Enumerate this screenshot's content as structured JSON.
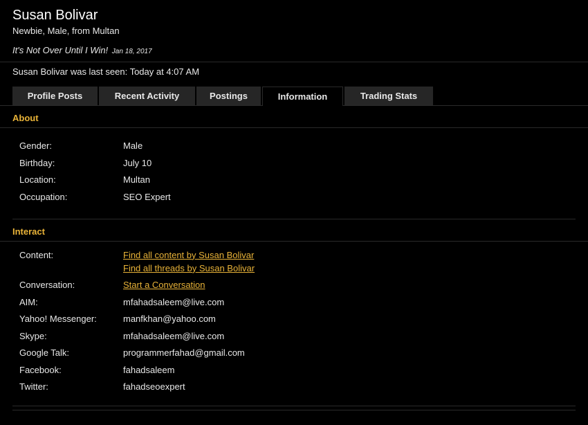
{
  "profile": {
    "name": "Susan Bolivar",
    "blurb": "Newbie, Male, from Multan",
    "status": "It's Not Over Until I Win!",
    "status_date": "Jan 18, 2017",
    "last_seen": "Susan Bolivar was last seen: Today at 4:07 AM"
  },
  "tabs": [
    {
      "label": "Profile Posts",
      "active": false
    },
    {
      "label": "Recent Activity",
      "active": false
    },
    {
      "label": "Postings",
      "active": false
    },
    {
      "label": "Information",
      "active": true
    },
    {
      "label": "Trading Stats",
      "active": false
    }
  ],
  "about": {
    "heading": "About",
    "rows": [
      {
        "label": "Gender:",
        "value": "Male"
      },
      {
        "label": "Birthday:",
        "value": "July 10"
      },
      {
        "label": "Location:",
        "value": "Multan"
      },
      {
        "label": "Occupation:",
        "value": "SEO Expert"
      }
    ]
  },
  "interact": {
    "heading": "Interact",
    "content_label": "Content:",
    "content_link_1": "Find all content by Susan Bolivar",
    "content_link_2": "Find all threads by Susan Bolivar",
    "conversation_label": "Conversation:",
    "conversation_link": "Start a Conversation",
    "rows": [
      {
        "label": "AIM:",
        "value": "mfahadsaleem@live.com"
      },
      {
        "label": "Yahoo! Messenger:",
        "value": "manfkhan@yahoo.com"
      },
      {
        "label": "Skype:",
        "value": "mfahadsaleem@live.com"
      },
      {
        "label": "Google Talk:",
        "value": "programmerfahad@gmail.com"
      },
      {
        "label": "Facebook:",
        "value": "fahadsaleem"
      },
      {
        "label": "Twitter:",
        "value": "fahadseoexpert"
      }
    ]
  },
  "colors": {
    "background": "#000000",
    "accent": "#e9b338",
    "tab_background": "#262626",
    "text": "#e8e8e8"
  }
}
